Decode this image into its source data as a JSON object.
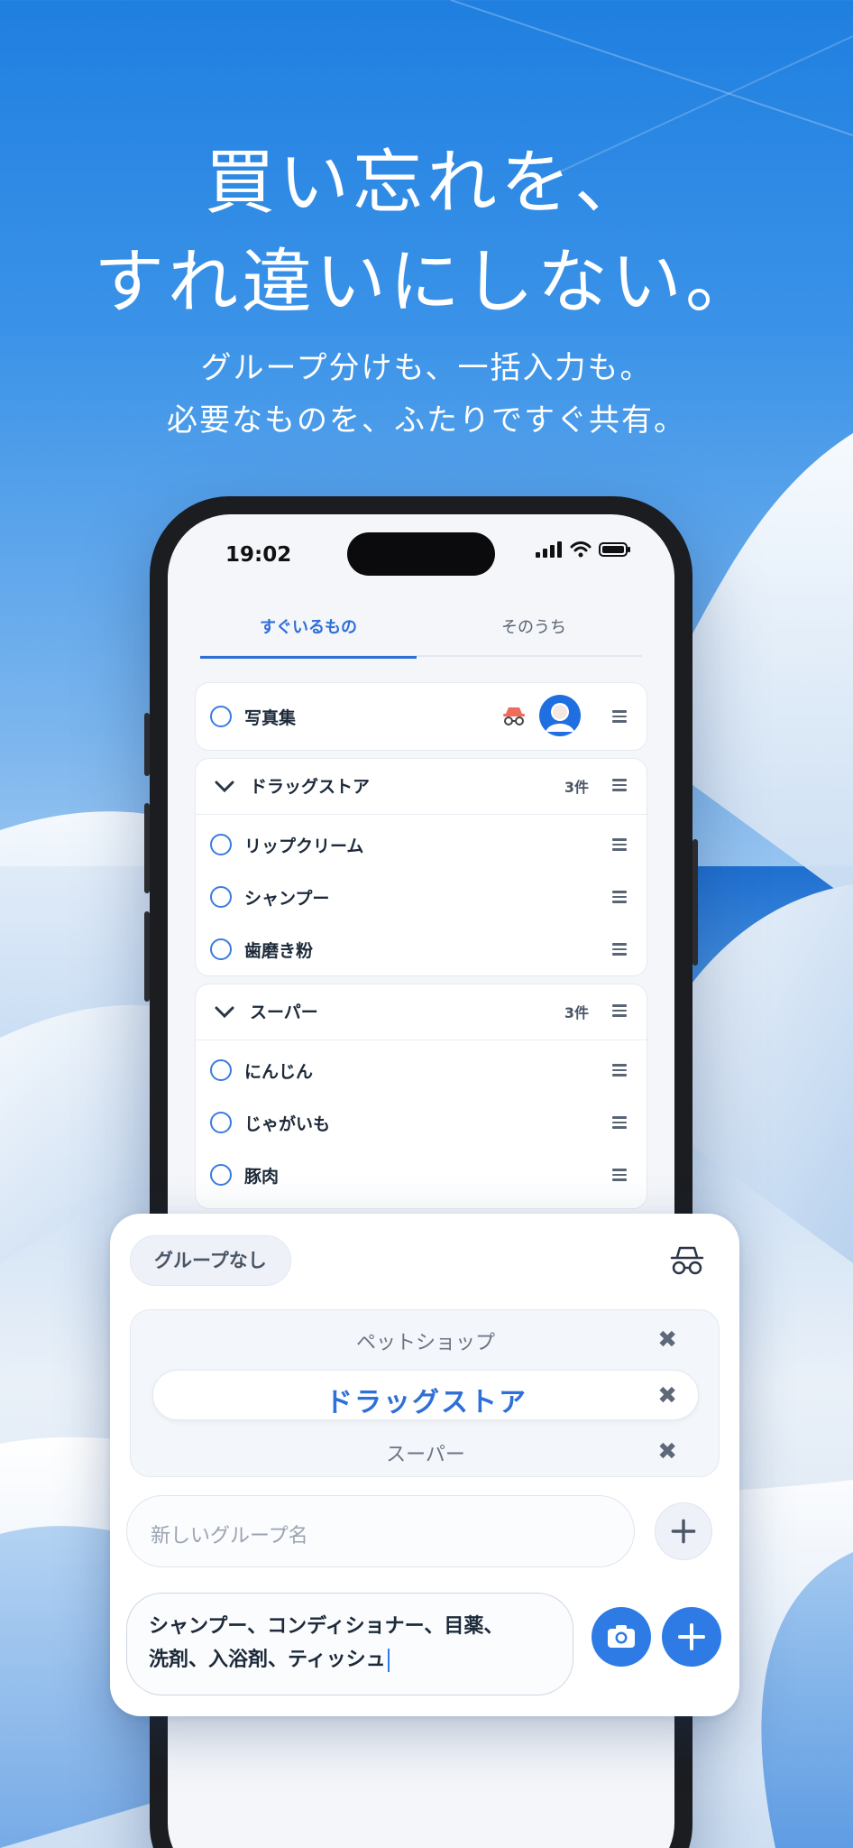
{
  "hero": {
    "headline_line1": "買い忘れを、",
    "headline_line2": "すれ違いにしない。",
    "sub_line1": "グループ分けも、一括入力も。",
    "sub_line2": "必要なものを、ふたりですぐ共有。"
  },
  "status_bar": {
    "time": "19:02"
  },
  "tabs": [
    {
      "label": "すぐいるもの",
      "active": true
    },
    {
      "label": "そのうち",
      "active": false
    }
  ],
  "top_item": {
    "label": "写真集"
  },
  "groups": [
    {
      "title": "ドラッグストア",
      "count": "3件",
      "items": [
        "リップクリーム",
        "シャンプー",
        "歯磨き粉"
      ]
    },
    {
      "title": "スーパー",
      "count": "3件",
      "items": [
        "にんじん",
        "じゃがいも",
        "豚肉"
      ]
    }
  ],
  "sheet": {
    "chip_label": "グループなし",
    "picker": {
      "above": "ペットショップ",
      "selected": "ドラッグストア",
      "below": "スーパー",
      "close_glyph": "✖"
    },
    "new_group_placeholder": "新しいグループ名",
    "input_line1": "シャンプー、コンディショナー、目薬、",
    "input_line2": "洗剤、入浴剤、ティッシュ"
  },
  "colors": {
    "accent": "#2f7be6",
    "tab_active": "#2f6fd8"
  }
}
